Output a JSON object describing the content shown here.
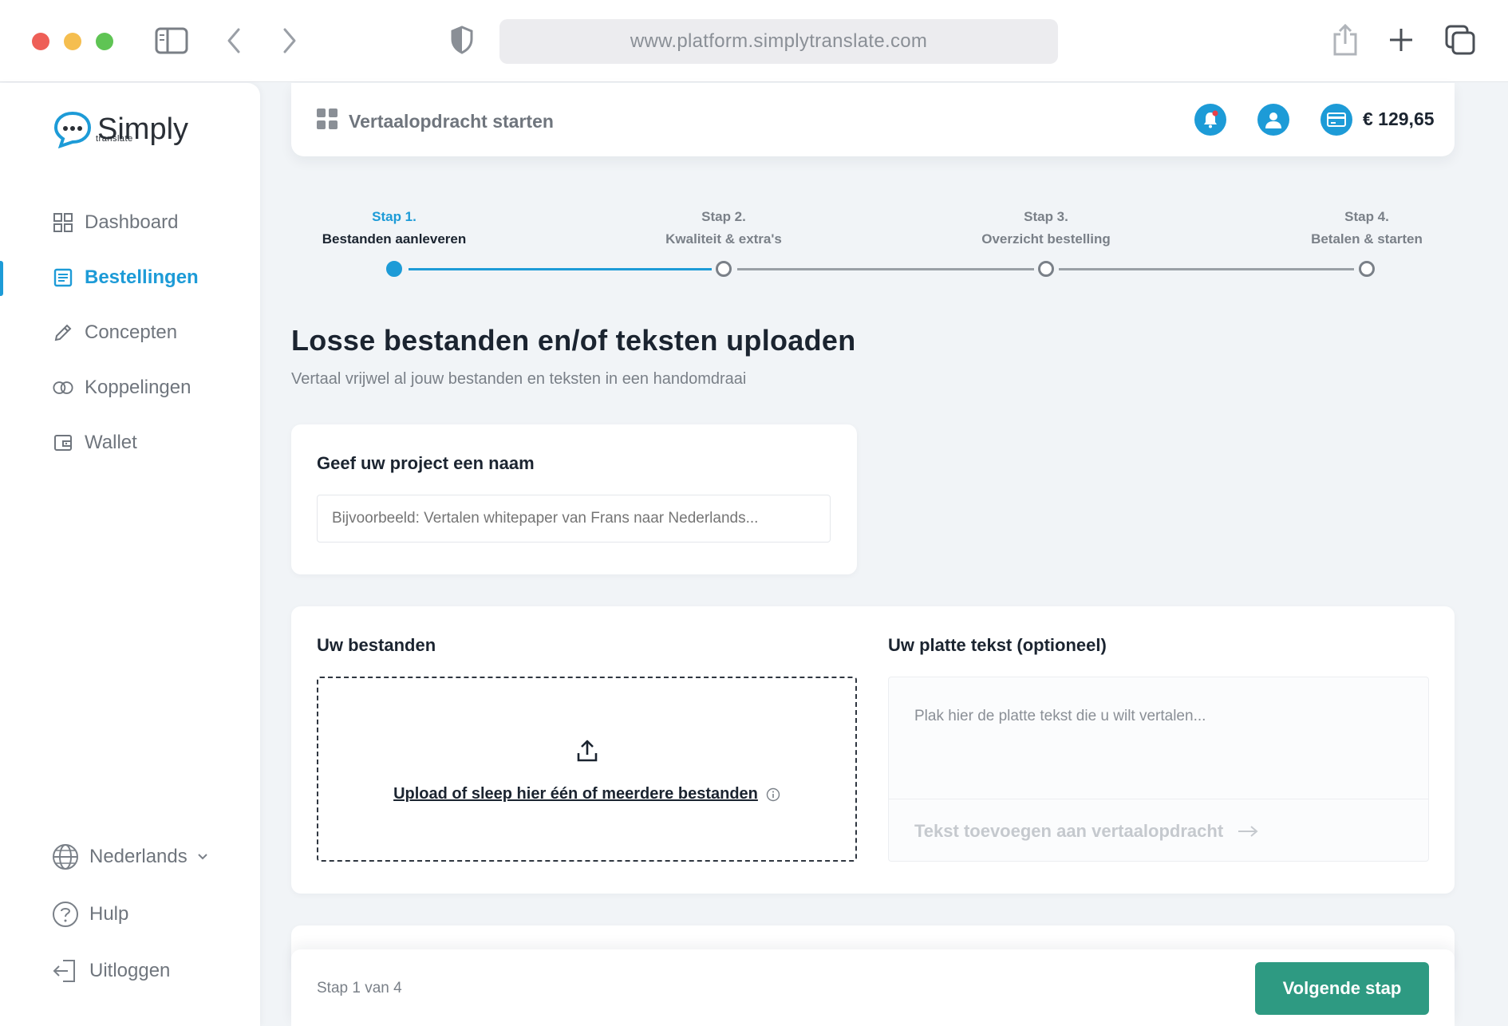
{
  "browser": {
    "url": "www.platform.simplytranslate.com"
  },
  "brand": {
    "name": "Simply",
    "tagline": "translate",
    "accent": "#1d9bd7",
    "primary_button": "#2e9a82"
  },
  "sidebar": {
    "items": [
      {
        "label": "Dashboard",
        "icon": "grid-icon",
        "active": false
      },
      {
        "label": "Bestellingen",
        "icon": "list-icon",
        "active": true
      },
      {
        "label": "Concepten",
        "icon": "pencil-icon",
        "active": false
      },
      {
        "label": "Koppelingen",
        "icon": "link-circles-icon",
        "active": false
      },
      {
        "label": "Wallet",
        "icon": "wallet-icon",
        "active": false
      }
    ],
    "bottom": {
      "language": "Nederlands",
      "help": "Hulp",
      "logout": "Uitloggen"
    }
  },
  "header": {
    "title": "Vertaalopdracht starten",
    "balance": "€ 129,65"
  },
  "stepper": {
    "steps": [
      {
        "num": "Stap 1.",
        "label": "Bestanden aanleveren",
        "active": true
      },
      {
        "num": "Stap 2.",
        "label": "Kwaliteit & extra's",
        "active": false
      },
      {
        "num": "Stap 3.",
        "label": "Overzicht bestelling",
        "active": false
      },
      {
        "num": "Stap 4.",
        "label": "Betalen & starten",
        "active": false
      }
    ]
  },
  "main": {
    "title": "Losse bestanden en/of teksten uploaden",
    "subtitle": "Vertaal vrijwel al jouw bestanden en teksten in een handomdraai",
    "project": {
      "heading": "Geef uw project een naam",
      "placeholder": "Bijvoorbeeld: Vertalen whitepaper van Frans naar Nederlands...",
      "value": ""
    },
    "files": {
      "heading": "Uw bestanden",
      "upload_label": "Upload of sleep hier één of meerdere bestanden"
    },
    "plaintext": {
      "heading": "Uw platte tekst (optioneel)",
      "placeholder": "Plak hier de platte tekst die u wilt vertalen...",
      "add_label": "Tekst toevoegen aan vertaalopdracht"
    }
  },
  "footer": {
    "step_text": "Stap 1 van 4",
    "next_label": "Volgende stap"
  }
}
